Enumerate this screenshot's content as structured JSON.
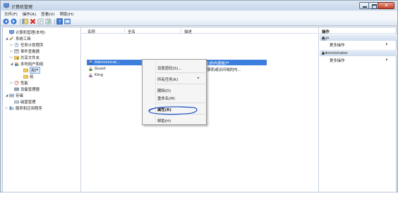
{
  "window": {
    "title": "计算机管理"
  },
  "menubar": {
    "items": [
      "文件(F)",
      "操作(A)",
      "查看(V)",
      "帮助(H)"
    ]
  },
  "toolbar": {
    "buttons": [
      "back-icon",
      "forward-icon",
      "show-tree-icon",
      "delete-icon",
      "properties-icon",
      "refresh-icon",
      "help-icon",
      "console-icon"
    ]
  },
  "tree": {
    "nodes": [
      {
        "label": "计算机管理(本地)",
        "expander": "",
        "icon": "computer-icon"
      },
      {
        "label": "系统工具",
        "expander": "◢",
        "icon": "tools-icon"
      },
      {
        "label": "任务计划程序",
        "expander": "▷",
        "icon": "clock-icon"
      },
      {
        "label": "事件查看器",
        "expander": "▷",
        "icon": "event-viewer-icon"
      },
      {
        "label": "共享文件夹",
        "expander": "▷",
        "icon": "shared-folder-icon"
      },
      {
        "label": "本地用户和组",
        "expander": "◢",
        "icon": "users-groups-icon"
      },
      {
        "label": "用户",
        "expander": "",
        "icon": "folder-icon"
      },
      {
        "label": "组",
        "expander": "",
        "icon": "folder-icon"
      },
      {
        "label": "性能",
        "expander": "▷",
        "icon": "performance-icon"
      },
      {
        "label": "设备管理器",
        "expander": "",
        "icon": "device-manager-icon"
      },
      {
        "label": "存储",
        "expander": "◢",
        "icon": "storage-icon"
      },
      {
        "label": "磁盘管理",
        "expander": "",
        "icon": "disk-icon"
      },
      {
        "label": "服务和应用程序",
        "expander": "▷",
        "icon": "services-icon"
      }
    ]
  },
  "list": {
    "columns": [
      "名称",
      "全名",
      "描述"
    ],
    "rows": [
      {
        "name": "Administrat...",
        "fullname": "",
        "desc": "管理计算机(域)的内置帐户"
      },
      {
        "name": "Guest",
        "fullname": "",
        "desc": "供来宾访问计算机或访问域的内..."
      },
      {
        "name": "King",
        "fullname": "",
        "desc": ""
      }
    ]
  },
  "context_menu": {
    "items": [
      {
        "label": "设置密码(S)...",
        "submenu": false
      },
      {
        "label": "所有任务(K)",
        "submenu": true
      },
      {
        "label": "删除(D)",
        "submenu": false
      },
      {
        "label": "重命名(M)",
        "submenu": false
      },
      {
        "label": "属性(R)",
        "submenu": false
      },
      {
        "label": "帮助(H)",
        "submenu": false
      }
    ],
    "submenu_arrow": "▸",
    "annotation_color": "#2a5cc7"
  },
  "actions": {
    "header": "操作",
    "sections": [
      {
        "title": "用户",
        "items": [
          {
            "label": "更多操作",
            "arrow": "▸"
          }
        ],
        "toggle": "▲"
      },
      {
        "title": "Administrator",
        "items": [
          {
            "label": "更多操作",
            "arrow": "▸"
          }
        ],
        "toggle": "▲"
      }
    ]
  },
  "colors": {
    "selection": "#3c7fdd",
    "accent": "#2a5cc7",
    "title_bar": "#c6d6ea",
    "close_button": "#c24026"
  }
}
